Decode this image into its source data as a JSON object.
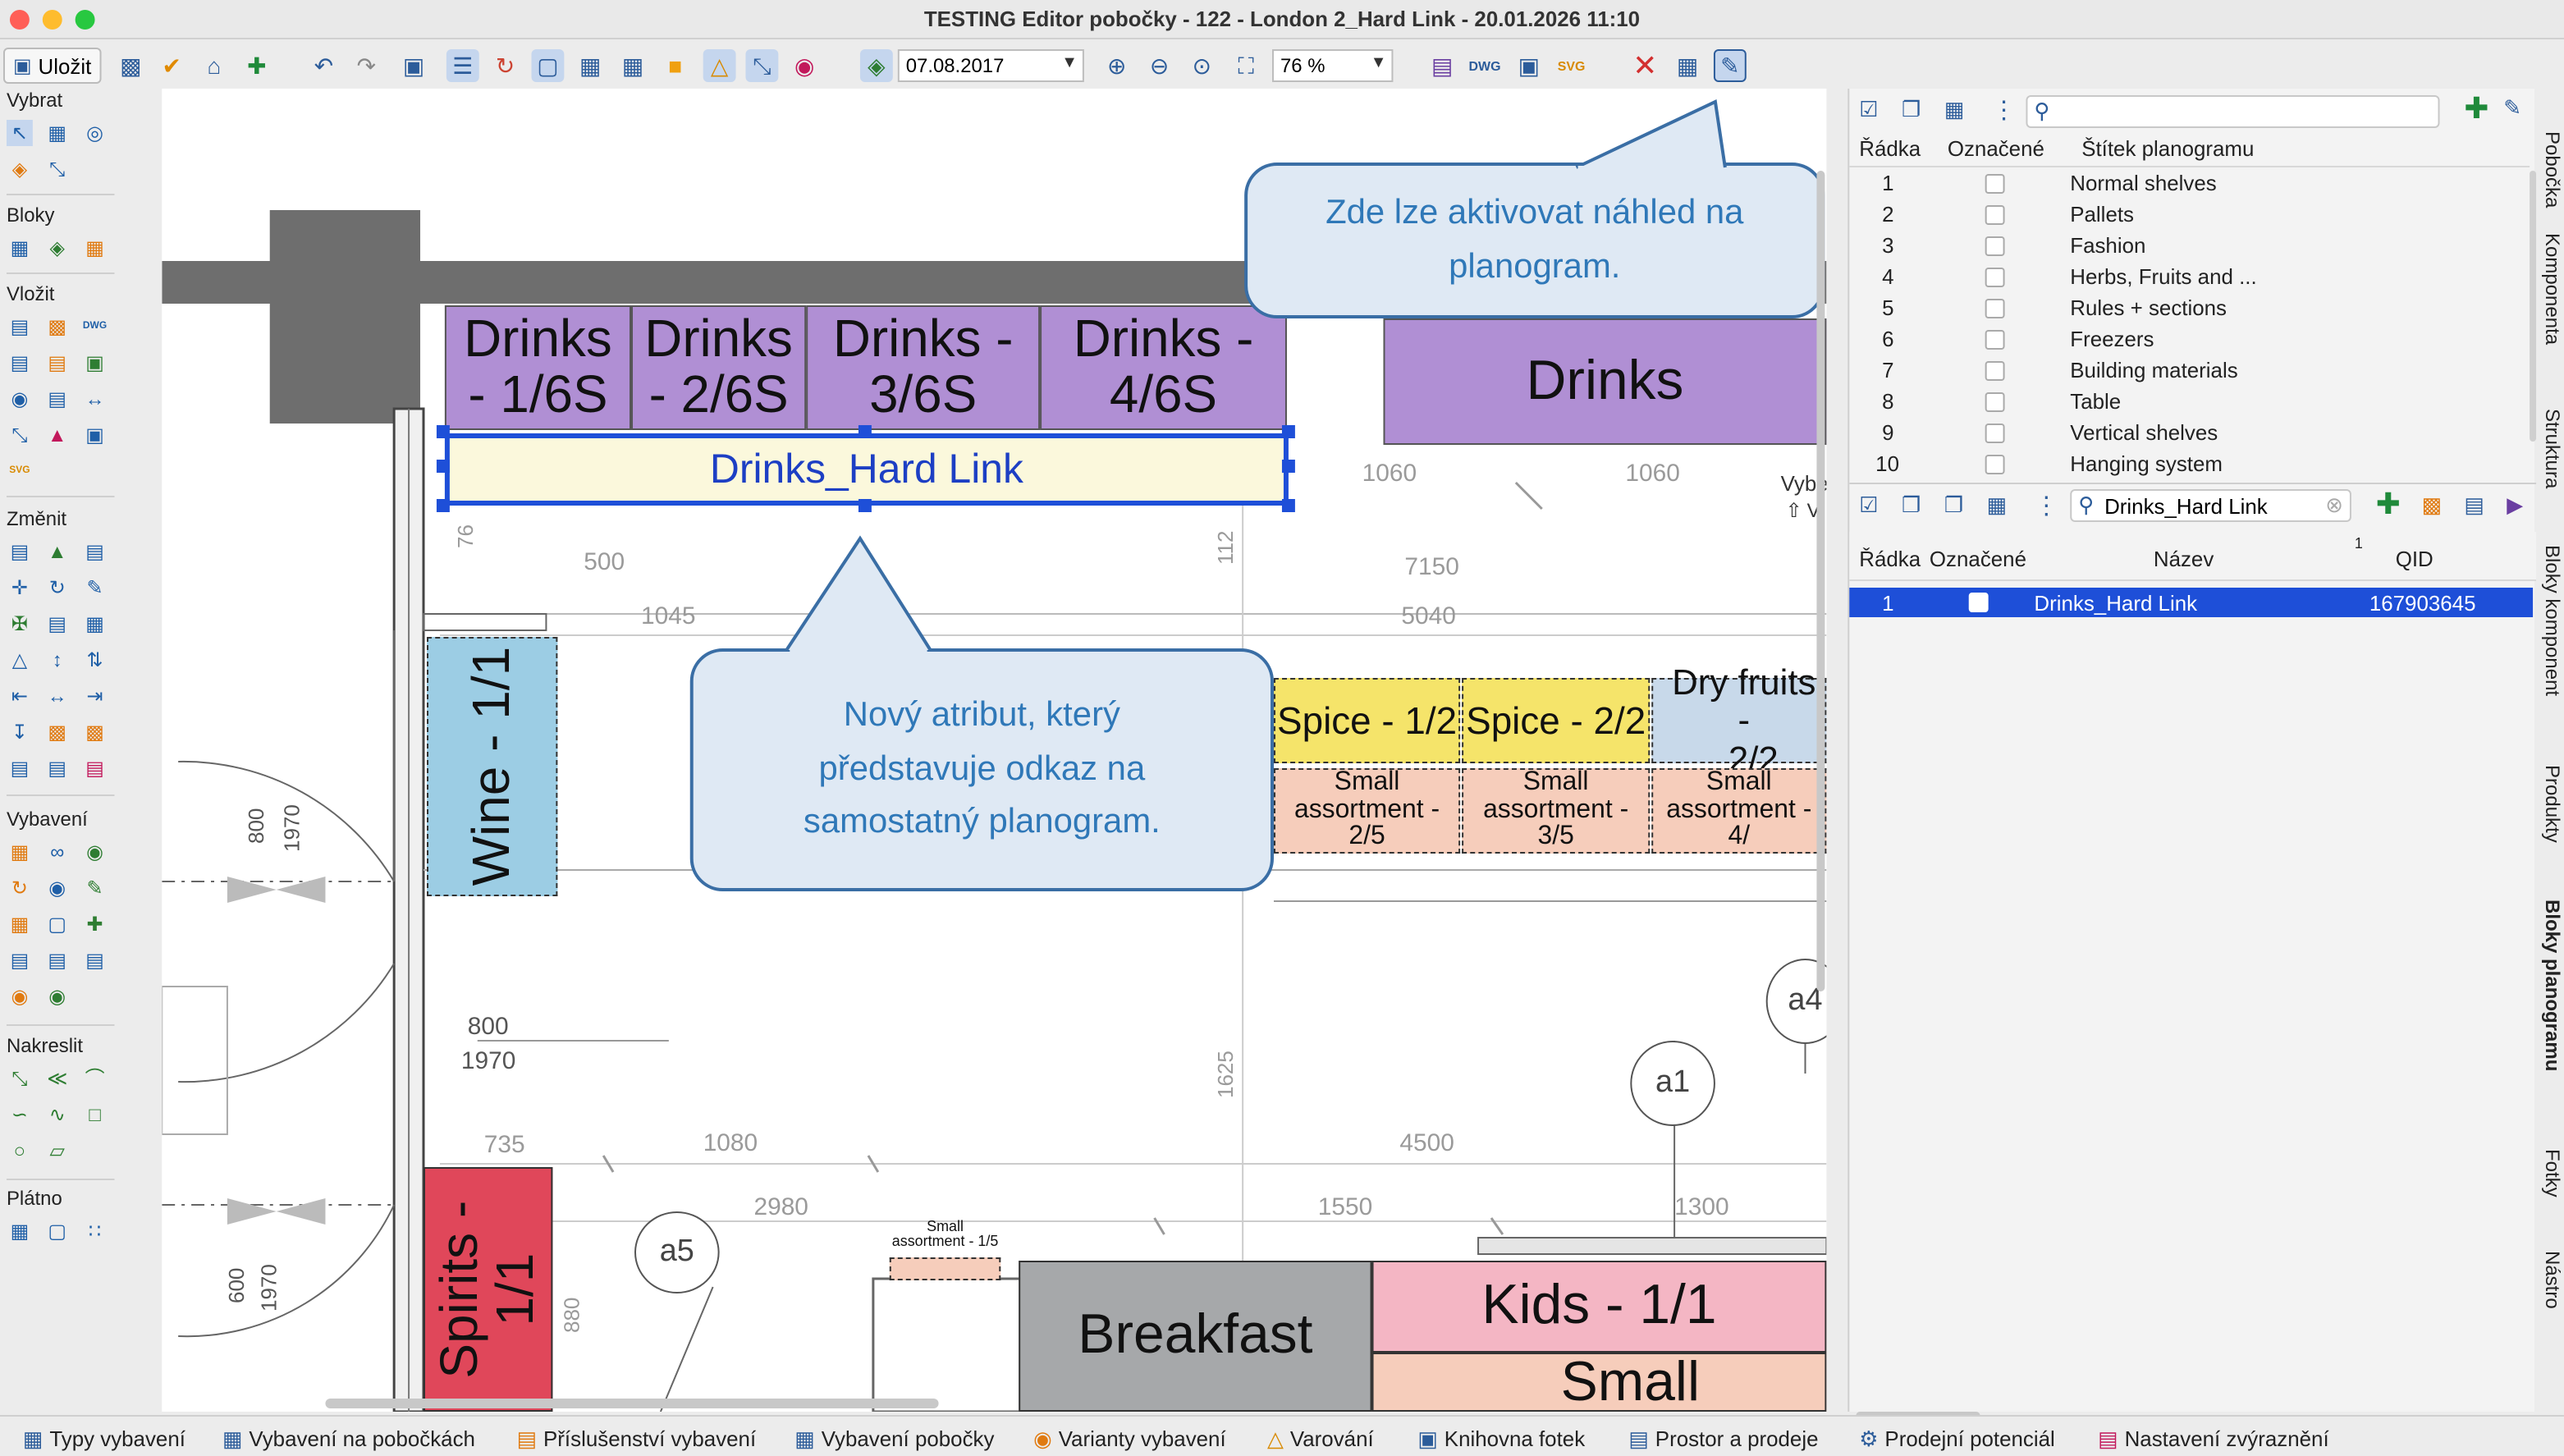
{
  "window": {
    "title": "TESTING Editor pobočky - 122 - London 2_Hard Link - 20.01.2026 11:10"
  },
  "toolbar": {
    "save_label": "Uložit",
    "date": "07.08.2017",
    "zoom": "76 %"
  },
  "palette": {
    "sections": {
      "select": "Vybrat",
      "blocks": "Bloky",
      "insert": "Vložit",
      "modify": "Změnit",
      "equipment": "Vybavení",
      "draw": "Nakreslit",
      "canvas": "Plátno"
    },
    "dwg_label": "DWG",
    "svg_label": "SVG"
  },
  "canvas": {
    "drinks_blocks": [
      {
        "line1": "Drinks",
        "line2": "- 1/6S"
      },
      {
        "line1": "Drinks",
        "line2": "- 2/6S"
      },
      {
        "line1": "Drinks -",
        "line2": "3/6S"
      },
      {
        "line1": "Drinks -",
        "line2": "4/6S"
      }
    ],
    "drinks_big": "Drinks",
    "hard_link": "Drinks_Hard Link",
    "wine": "Wine - 1/1",
    "spirits_line1": "Spirits -",
    "spirits_line2": "1/1",
    "spice": [
      "Spice - 1/2",
      "Spice - 2/2"
    ],
    "dry_fruits": {
      "line1": "Dry fruits -",
      "line2": "2/2"
    },
    "small_assortment": [
      {
        "line1": "Small",
        "line2": "assortment - 2/5"
      },
      {
        "line1": "Small",
        "line2": "assortment - 3/5"
      },
      {
        "line1": "Small",
        "line2": "assortment - 4/"
      }
    ],
    "small_assortment_tiny": {
      "line1": "Small",
      "line2": "assortment - 1/5"
    },
    "breakfast": "Breakfast",
    "kids": "Kids - 1/1",
    "small_assortment_big": "Small assortmen",
    "circles": [
      "a1",
      "a4",
      "a5"
    ],
    "dims": {
      "d1060a": "1060",
      "d1060b": "1060",
      "d500": "500",
      "d7150": "7150",
      "d1045": "1045",
      "d5040": "5040",
      "d800a": "800",
      "d1970": "1970",
      "d735": "735",
      "d1080": "1080",
      "d4500": "4500",
      "d2980": "2980",
      "d1550": "1550",
      "d1300": "1300",
      "v800": "800",
      "v1970a": "1970",
      "v600": "600",
      "v1970b": "1970",
      "v1625": "1625",
      "v112": "112",
      "v76": "76",
      "v880": "880"
    },
    "side_label_1": "Vybe",
    "side_label_2": "V"
  },
  "callouts": {
    "preview": "Zde lze aktivovat náhled na planogram.",
    "new_attribute": "Nový atribut, který představuje odkaz na samostatný planogram."
  },
  "labels_table": {
    "headers": [
      "Řádka",
      "Označené",
      "Štítek planogramu"
    ],
    "rows": [
      {
        "n": "1",
        "label": "Normal shelves"
      },
      {
        "n": "2",
        "label": "Pallets"
      },
      {
        "n": "3",
        "label": "Fashion"
      },
      {
        "n": "4",
        "label": "Herbs, Fruits and ..."
      },
      {
        "n": "5",
        "label": "Rules + sections"
      },
      {
        "n": "6",
        "label": "Freezers"
      },
      {
        "n": "7",
        "label": "Building materials"
      },
      {
        "n": "8",
        "label": "Table"
      },
      {
        "n": "9",
        "label": "Vertical shelves"
      },
      {
        "n": "10",
        "label": "Hanging system"
      }
    ]
  },
  "blocks_table": {
    "search_value": "Drinks_Hard Link",
    "headers": [
      "Řádka",
      "Označené",
      "Název",
      "QID"
    ],
    "sort_indicator": "1",
    "rows": [
      {
        "n": "1",
        "name": "Drinks_Hard Link",
        "qid": "167903645"
      }
    ]
  },
  "side_tabs": [
    "Pobočka",
    "Komponenta",
    "Struktura",
    "Bloky komponent",
    "Produkty",
    "Bloky planogramu",
    "Fotky",
    "Nástro"
  ],
  "bottom_tabs": [
    "Typy vybavení",
    "Vybavení na pobočkách",
    "Příslušenství vybavení",
    "Vybavení pobočky",
    "Varianty vybavení",
    "Varování",
    "Knihovna fotek",
    "Prostor a prodeje",
    "Prodejní potenciál",
    "Nastavení zvýraznění"
  ],
  "colors": {
    "accent": "#2c5c9a",
    "selection": "#1e4fd8",
    "drinks": "#b08fd4",
    "wine": "#9ccde4",
    "spirits": "#e0475a",
    "spice": "#f5e46a",
    "small_assortment": "#f6cdbb",
    "breakfast": "#a6a8aa",
    "kids": "#f4b6c4",
    "callout_bg": "#dfe9f4"
  }
}
